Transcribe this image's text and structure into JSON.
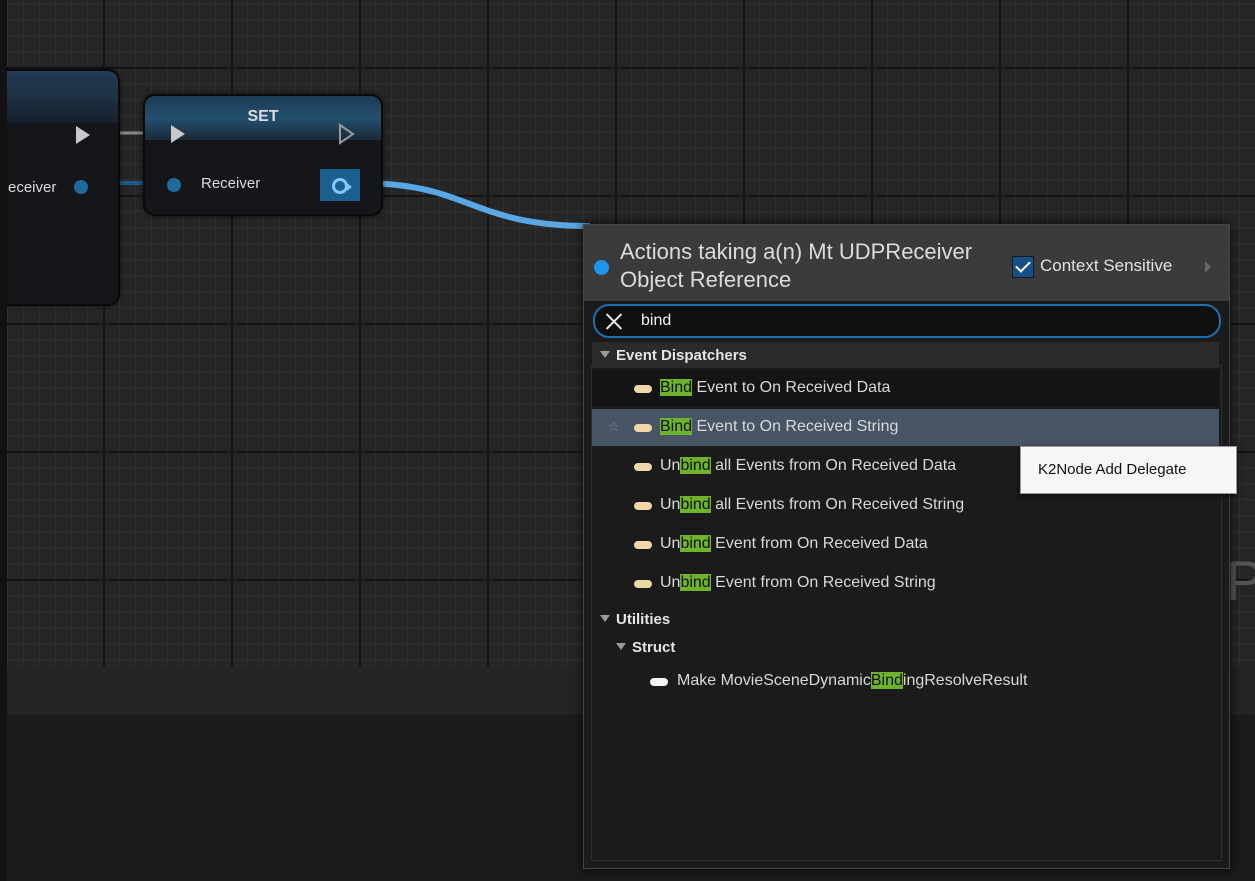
{
  "graph": {
    "prev_node_pin_label": "eceiver",
    "set_node_title": "SET",
    "set_node_pin_label": "Receiver",
    "background_letter": "P",
    "wire_color": "#5aa7e6",
    "object_pin_color": "#1c6fb0"
  },
  "action_menu": {
    "title": "Actions taking a(n) Mt UDPReceiver Object Reference",
    "context_sensitive_label": "Context Sensitive",
    "context_sensitive_checked": true,
    "search": {
      "value": "bind",
      "placeholder": ""
    },
    "categories": [
      {
        "label": "Event Dispatchers",
        "items": [
          {
            "prefix": "",
            "match": "Bind",
            "suffix": " Event to On Received Data"
          },
          {
            "prefix": "",
            "match": "Bind",
            "suffix": " Event to On Received String",
            "highlighted": true
          },
          {
            "prefix": "Un",
            "match": "bind",
            "suffix": " all Events from On Received Data"
          },
          {
            "prefix": "Un",
            "match": "bind",
            "suffix": " all Events from On Received String"
          },
          {
            "prefix": "Un",
            "match": "bind",
            "suffix": " Event from On Received Data"
          },
          {
            "prefix": "Un",
            "match": "bind",
            "suffix": " Event from On Received String"
          }
        ]
      },
      {
        "label": "Utilities",
        "subcategories": [
          {
            "label": "Struct",
            "items": [
              {
                "prefix": "Make MovieSceneDynamic",
                "match": "Bind",
                "suffix": "ingResolveResult"
              }
            ]
          }
        ]
      }
    ],
    "match_highlight_color": "#6fb32c",
    "selected_row_color": "#485565"
  },
  "tooltip": {
    "text": "K2Node Add Delegate"
  }
}
